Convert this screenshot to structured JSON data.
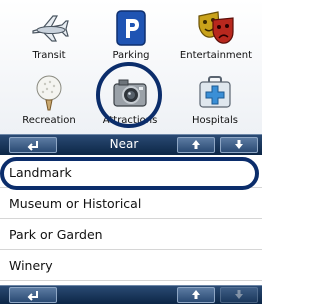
{
  "categories": [
    {
      "label": "Transit",
      "icon": "airplane-icon"
    },
    {
      "label": "Parking",
      "icon": "parking-icon"
    },
    {
      "label": "Entertainment",
      "icon": "theater-masks-icon"
    },
    {
      "label": "Recreation",
      "icon": "golf-ball-icon"
    },
    {
      "label": "Attractions",
      "icon": "camera-icon"
    },
    {
      "label": "Hospitals",
      "icon": "first-aid-icon"
    }
  ],
  "toolbar": {
    "title": "Near",
    "back": "back-arrow-icon",
    "up": "arrow-up-icon",
    "down": "arrow-down-icon"
  },
  "list": {
    "items": [
      "Landmark",
      "Museum or Historical",
      "Park or Garden",
      "Winery"
    ]
  },
  "colors": {
    "bar": "#0c2646",
    "highlight": "#0b2d6b"
  }
}
